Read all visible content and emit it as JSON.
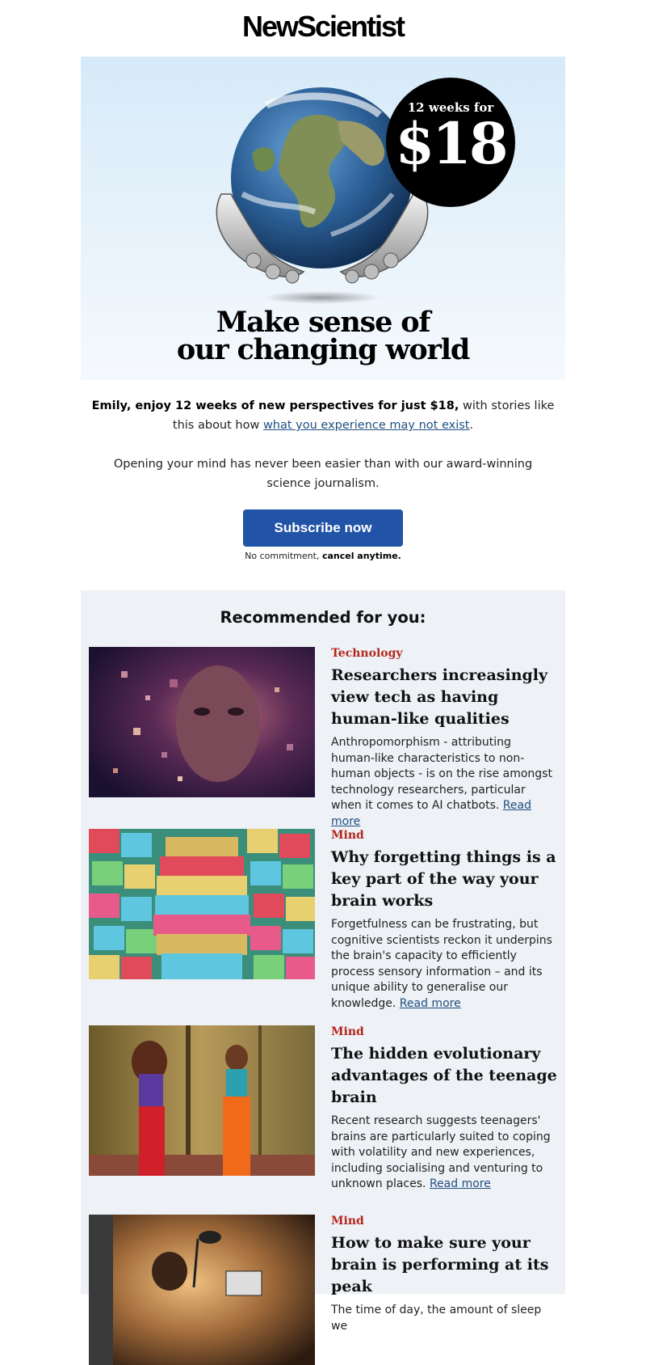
{
  "brand": {
    "logo": "NewScientist"
  },
  "hero": {
    "badge_top": "12 weeks for",
    "badge_price": "$18",
    "headline_line1": "Make sense of",
    "headline_line2": "our changing world"
  },
  "intro": {
    "bold": "Emily, enjoy 12 weeks of new perspectives for just $18,",
    "rest": " with stories like this about how ",
    "link": "what you experience may not exist",
    "end": ".",
    "paragraph2": "Opening your mind has never been easier than with our award-winning science journalism."
  },
  "cta": {
    "button_label": "Subscribe now",
    "note_plain": "No commitment, ",
    "note_bold": "cancel anytime."
  },
  "recommended": {
    "title": "Recommended for you:",
    "read_more": "Read more",
    "items": [
      {
        "category": "Technology",
        "title": "Researchers increasingly view tech as having human-like qualities",
        "desc": "Anthropomorphism - attributing human-like characteristics to non-human objects - is on the rise amongst technology researchers, particular when it comes to AI chatbots. "
      },
      {
        "category": "Mind",
        "title": "Why forgetting things is a key part of the way your brain works",
        "desc": "Forgetfulness can be frustrating, but cognitive scientists reckon it underpins the brain's capacity to efficiently process sensory information – and its unique ability to generalise our knowledge. "
      },
      {
        "category": "Mind",
        "title": "The hidden evolutionary advantages of the teenage brain",
        "desc": "Recent research suggests teenagers' brains are particularly suited to coping with volatility and new experiences, including socialising and venturing to unknown places. "
      },
      {
        "category": "Mind",
        "title": "How to make sure your brain is performing at its peak",
        "desc": "The time of day, the amount of sleep we"
      }
    ]
  }
}
